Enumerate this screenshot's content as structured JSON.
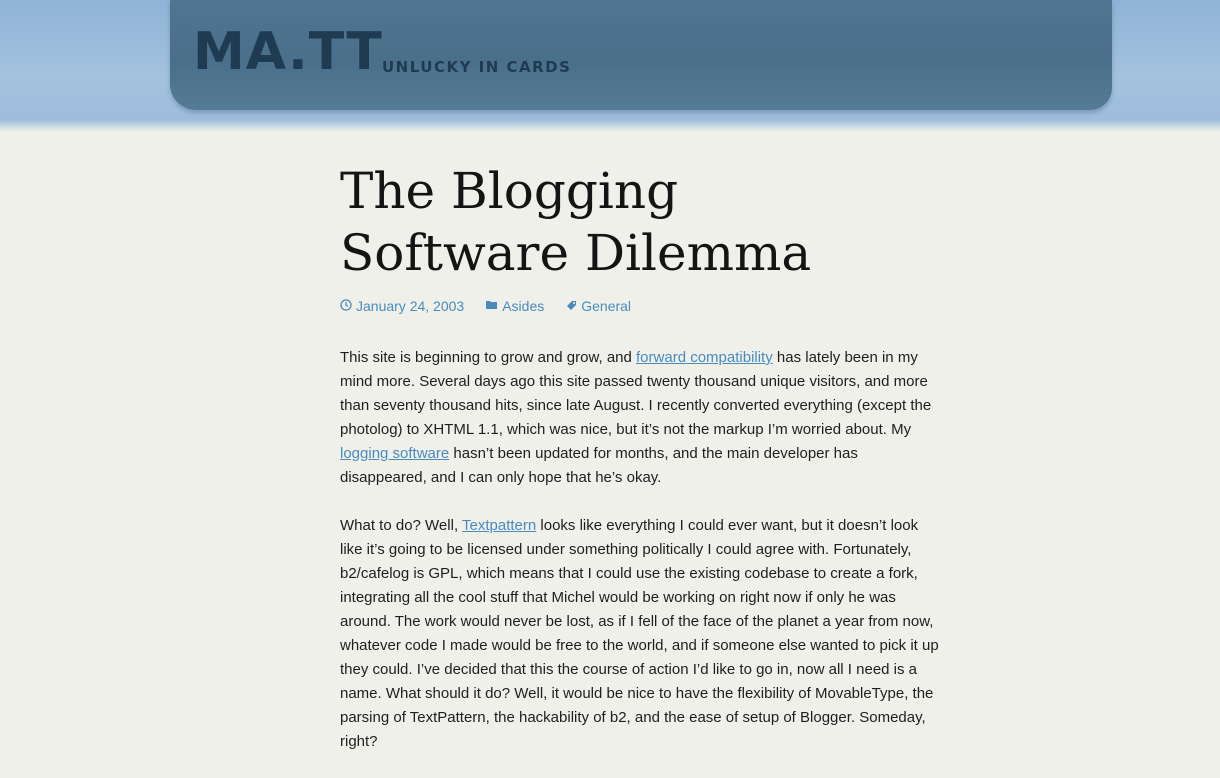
{
  "site": {
    "title": "MA.TT",
    "description": "UNLUCKY IN CARDS"
  },
  "post": {
    "title_line1": "The Blogging",
    "title_line2": "Software  Dilemma",
    "meta": {
      "date": "January 24, 2003",
      "format": "Asides",
      "tag": "General",
      "date_icon": "clock-icon",
      "format_icon": "folder-icon",
      "tag_icon": "tag-icon"
    },
    "p1": {
      "t1": "This site is beginning to grow and grow, and ",
      "link1": "forward compatibility",
      "t2": " has lately been in my mind more. Several days ago this site passed twenty thousand unique visitors, and more than seventy thousand hits, since late August. I recently converted everything (except the photolog) to XHTML 1.1, which was nice, but it’s not the markup I’m worried about. My ",
      "link2": "logging software",
      "t3": " hasn’t been updated for months, and the main developer has disappeared, and I can only hope that he’s okay."
    },
    "p2": {
      "t1": "What to do? Well, ",
      "link1": "Textpattern",
      "t2": " looks like everything I could ever want, but it doesn’t look like it’s going to be licensed under something politically I could agree with. Fortunately, b2/cafelog is GPL, which means that I could use the existing codebase to create a fork, integrating all the cool stuff that Michel would be working on right now if only he was around. The work would never be lost, as if I fell of the face of the planet a year from now, whatever code I made would be free to the world, and if someone else wanted to pick it up they could. I’ve decided that this the course of action I’d like to go in, now all I need is a name. What should it do? Well, it would be nice to have the flexibility of MovableType, the parsing of TextPattern, the hackability of b2, and the ease of setup of Blogger. Someday, right?"
    }
  },
  "colors": {
    "link": "#4a8bbd",
    "header_band": "#9dbcdc",
    "header_box": "#4f7592",
    "title_text": "#1f3b52",
    "background": "#f0f0ea"
  }
}
